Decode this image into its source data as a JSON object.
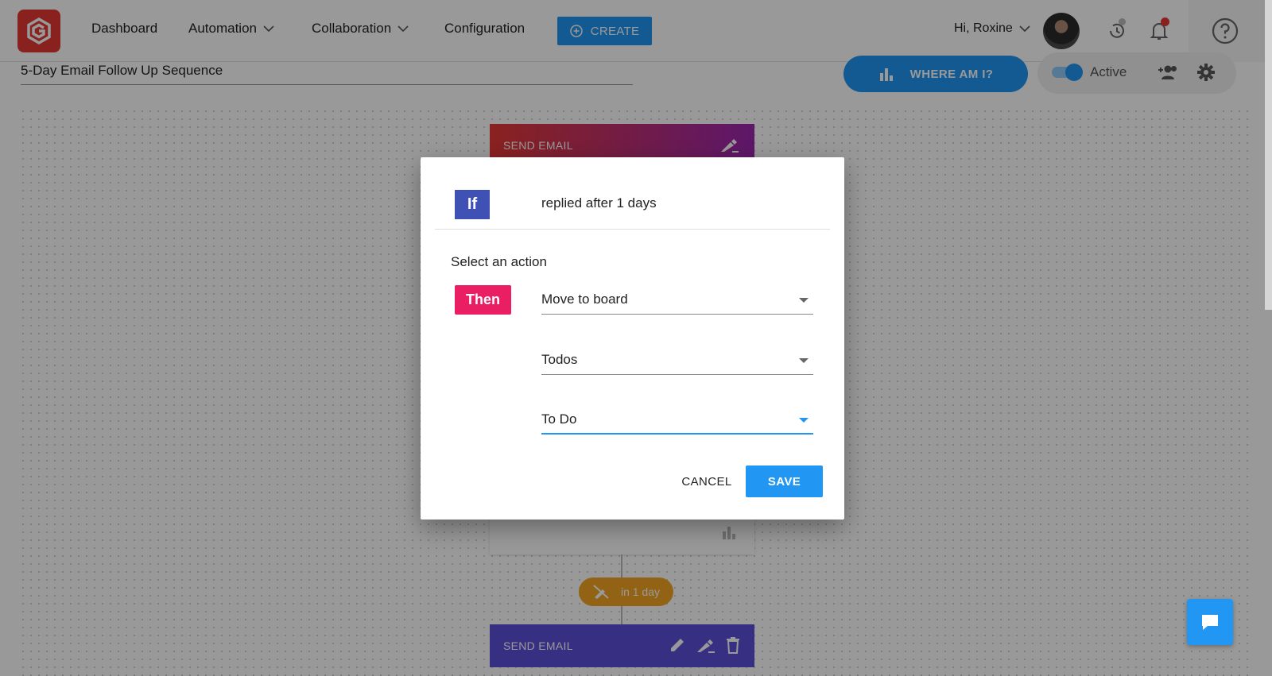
{
  "nav": {
    "items": [
      {
        "label": "Dashboard"
      },
      {
        "label": "Automation"
      },
      {
        "label": "Collaboration"
      },
      {
        "label": "Configuration"
      }
    ],
    "create_label": "CREATE",
    "greeting": "Hi, Roxine"
  },
  "sequence": {
    "title": "5-Day Email Follow Up Sequence",
    "where_label": "WHERE AM I?",
    "status_label": "Active",
    "active": true
  },
  "canvas": {
    "top_node_label": "SEND EMAIL",
    "delay_label": "in 1 day",
    "bottom_node_label": "SEND EMAIL"
  },
  "modal": {
    "if_label": "If",
    "condition": "replied after 1 days",
    "select_label": "Select an action",
    "then_label": "Then",
    "action_value": "Move to board",
    "board_value": "Todos",
    "column_value": "To Do",
    "cancel_label": "CANCEL",
    "save_label": "SAVE"
  },
  "colors": {
    "primary": "#2196f3",
    "if_badge": "#3f51b5",
    "then_badge": "#e91e63",
    "logo": "#e53935",
    "delay": "#f5a623"
  }
}
